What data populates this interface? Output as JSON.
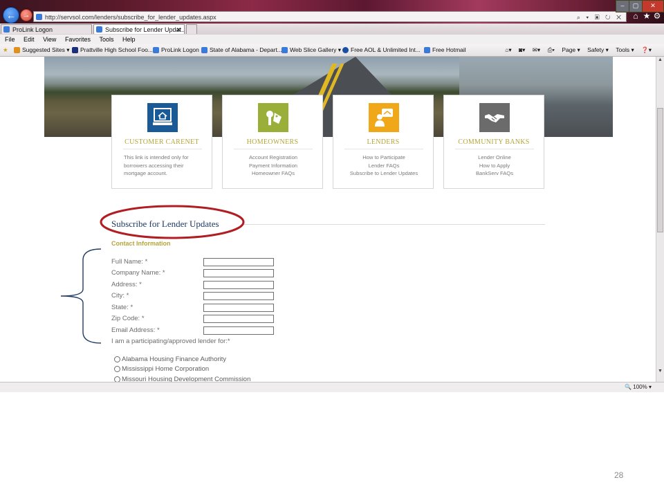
{
  "browser": {
    "url": "http://servsol.com/lenders/subscribe_for_lender_updates.aspx",
    "address_tools": "⌕ ▾ ▣ ↻ ✕",
    "tabs": [
      {
        "label": "ProLink Logon",
        "active": false
      },
      {
        "label": "Subscribe for Lender Updat...",
        "active": true
      }
    ],
    "tab_close": "✕",
    "menu": [
      "File",
      "Edit",
      "View",
      "Favorites",
      "Tools",
      "Help"
    ],
    "favorites": [
      {
        "label": "Suggested Sites ▾",
        "icon_color": "#e0901c"
      },
      {
        "label": "Prattville High School Foo...",
        "icon_color": "#1a2f7a"
      },
      {
        "label": "ProLink Logon",
        "icon_color": "#3a7ad8"
      },
      {
        "label": "State of Alabama - Depart...",
        "icon_color": "#3a7ad8"
      },
      {
        "label": "Web Slice Gallery ▾",
        "icon_color": "#3a7ad8"
      },
      {
        "label": "Free AOL & Unlimited Int...",
        "icon_color": "#1a4ea0"
      },
      {
        "label": "Free Hotmail",
        "icon_color": "#3a7ad8"
      }
    ],
    "command_bar": [
      "Page ▾",
      "Safety ▾",
      "Tools ▾",
      "❓▾"
    ],
    "zoom": "100%"
  },
  "cards": [
    {
      "title": "CUSTOMER CARENET",
      "icon": "computer-home-icon",
      "icon_color": "#1a5a96",
      "lines": [
        "This link is intended only for",
        "borrowers accessing their",
        "mortgage account."
      ]
    },
    {
      "title": "HOMEOWNERS",
      "icon": "keys-icon",
      "icon_color": "#9aae3a",
      "lines": [
        "Account Registration",
        "Payment Information",
        "Homeowner FAQs"
      ]
    },
    {
      "title": "LENDERS",
      "icon": "lender-person-icon",
      "icon_color": "#f0a818",
      "lines": [
        "How to Participate",
        "Lender FAQs",
        "Subscribe to Lender Updates"
      ]
    },
    {
      "title": "COMMUNITY BANKS",
      "icon": "handshake-icon",
      "icon_color": "#6b6b6b",
      "lines": [
        "Lender Online",
        "How to Apply",
        "BankServ FAQs"
      ]
    }
  ],
  "form": {
    "section_title": "Subscribe for Lender Updates",
    "contact_heading": "Contact Information",
    "fields": [
      {
        "label": "Full Name: *",
        "value": ""
      },
      {
        "label": "Company Name: *",
        "value": ""
      },
      {
        "label": "Address: *",
        "value": ""
      },
      {
        "label": "City: *",
        "value": ""
      },
      {
        "label": "State: *",
        "value": ""
      },
      {
        "label": "Zip Code: *",
        "value": ""
      },
      {
        "label": "Email Address: *",
        "value": ""
      }
    ],
    "lender_question": "I am a participating/approved lender for:*",
    "lender_options": [
      "Alabama Housing Finance Authority",
      "Mississippi Home Corporation",
      "Missouri Housing Development Commission"
    ]
  },
  "annotation_colors": {
    "ellipse": "#b01e24",
    "brace": "#1f3a67"
  },
  "slide_number": "28"
}
